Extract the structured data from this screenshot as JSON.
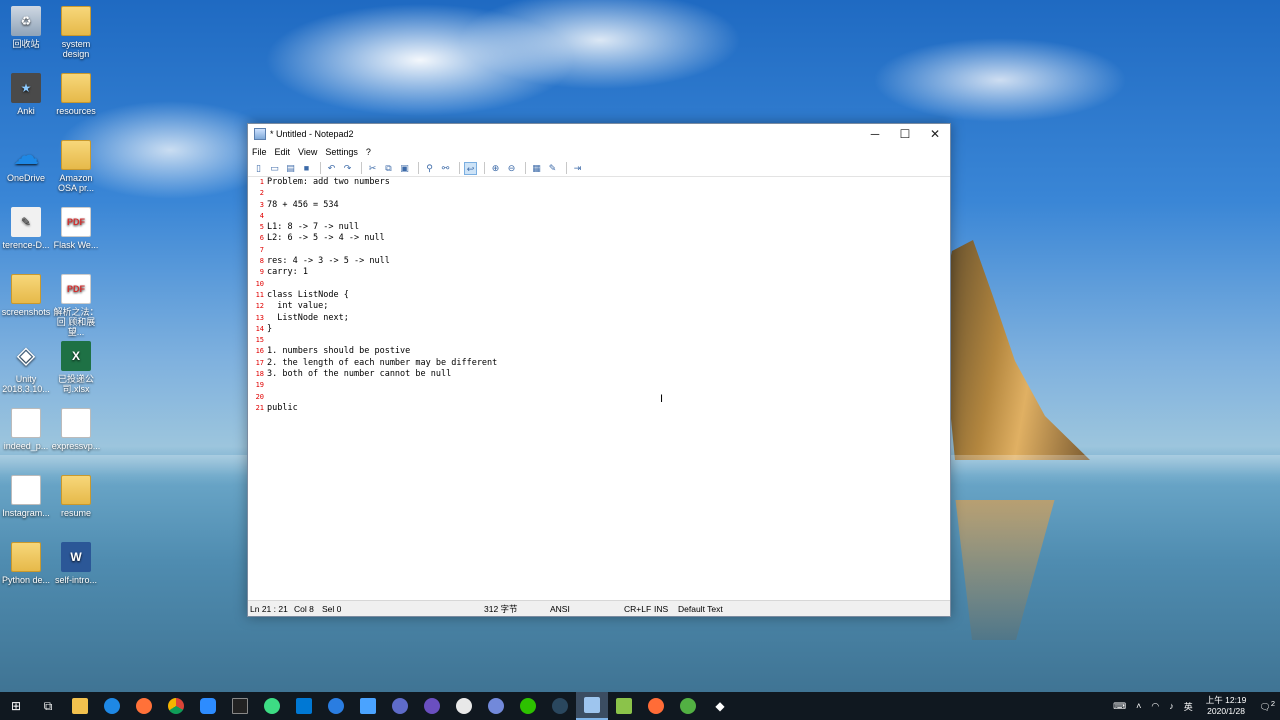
{
  "desktop": {
    "icons": [
      {
        "label": "回收站",
        "kind": "bin"
      },
      {
        "label": "system design",
        "kind": "folder"
      },
      {
        "label": "Anki",
        "kind": "anki"
      },
      {
        "label": "resources",
        "kind": "folder"
      },
      {
        "label": "OneDrive",
        "kind": "cloud"
      },
      {
        "label": "Amazon OSA pr...",
        "kind": "folder"
      },
      {
        "label": "terence-D...",
        "kind": "app"
      },
      {
        "label": "Flask We...",
        "kind": "pdf"
      },
      {
        "label": "screenshots",
        "kind": "folder"
      },
      {
        "label": "解析之法：回 顾和展望...",
        "kind": "pdf"
      },
      {
        "label": "Unity 2018.3.10...",
        "kind": "unity"
      },
      {
        "label": "已投递公司.xlsx",
        "kind": "excel"
      },
      {
        "label": "indeed_p...",
        "kind": "doc"
      },
      {
        "label": "expressvp...",
        "kind": "doc"
      },
      {
        "label": "Instagram...",
        "kind": "doc"
      },
      {
        "label": "resume",
        "kind": "folder"
      },
      {
        "label": "Python de...",
        "kind": "folder"
      },
      {
        "label": "self-intro...",
        "kind": "word"
      }
    ]
  },
  "window": {
    "title": "* Untitled - Notepad2",
    "minimize": "─",
    "maximize": "☐",
    "close": "✕",
    "menu": [
      "File",
      "Edit",
      "View",
      "Settings",
      "?"
    ]
  },
  "editor": {
    "lines": [
      "Problem: add two numbers",
      "",
      "78 + 456 = 534",
      "",
      "L1: 8 -> 7 -> null",
      "L2: 6 -> 5 -> 4 -> null",
      "",
      "res: 4 -> 3 -> 5 -> null",
      "carry: 1",
      "",
      "class ListNode {",
      "  int value;",
      "  ListNode next;",
      "}",
      "",
      "1. numbers should be postive",
      "2. the length of each number may be different",
      "3. both of the number cannot be null",
      "",
      "",
      "public"
    ]
  },
  "status": {
    "position": "Ln 21 : 21",
    "col": "Col 8",
    "sel": "Sel 0",
    "size": "312 字节",
    "encoding": "ANSI",
    "eol": "CR+LF",
    "mode": "INS",
    "scheme": "Default Text"
  },
  "taskbar": {
    "apps": [
      "start",
      "task-view",
      "file-explorer",
      "edge",
      "firefox",
      "chrome",
      "zoom",
      "terminal",
      "android-studio",
      "vscode",
      "maps",
      "mail",
      "obs",
      "eclipse",
      "slack",
      "discord",
      "wechat",
      "steam",
      "notepad2",
      "notepad-plus",
      "postman",
      "xbox",
      "unity"
    ],
    "lang": "英",
    "time": "上午 12:19",
    "date": "2020/1/28",
    "notifications": "2"
  }
}
